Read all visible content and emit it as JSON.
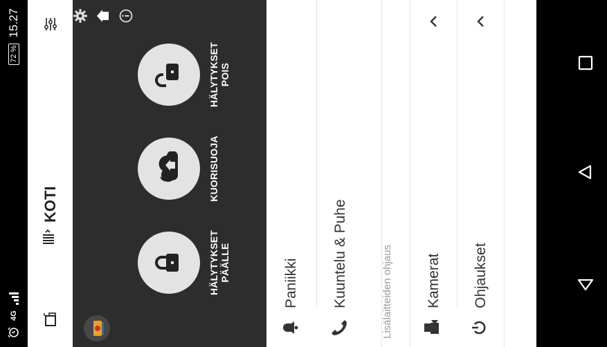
{
  "status_bar": {
    "network": "4G",
    "battery": "72 %",
    "time": "15.27"
  },
  "app_bar": {
    "title": "KOTI",
    "icons": [
      "device-icon",
      "menu-icon",
      "filter-icon"
    ]
  },
  "control_panel": {
    "buttons": [
      {
        "label": "HÄLYTYKSET PÄÄLLE",
        "icon": "lock-closed-icon"
      },
      {
        "label": "KUORISUOJA",
        "icon": "night-home-icon"
      },
      {
        "label": "HÄLYTYKSET POIS",
        "icon": "lock-open-icon"
      }
    ],
    "side_icons": [
      "settings-icon",
      "home-icon",
      "info-icon"
    ]
  },
  "list": {
    "items": [
      {
        "label": "Paniikki",
        "icon": "bell-icon"
      },
      {
        "label": "Kuuntelu & Puhe",
        "icon": "phone-icon"
      }
    ],
    "section_header": "Lisälaitteiden ohjaus",
    "expandables": [
      {
        "label": "Kamerat",
        "icon": "camera-icon",
        "chevron": "chevron-up-icon"
      },
      {
        "label": "Ohjaukset",
        "icon": "power-icon",
        "chevron": "chevron-up-icon"
      }
    ]
  },
  "nav_bar": {
    "buttons": [
      "back-icon",
      "home-nav-icon",
      "recents-icon"
    ]
  }
}
